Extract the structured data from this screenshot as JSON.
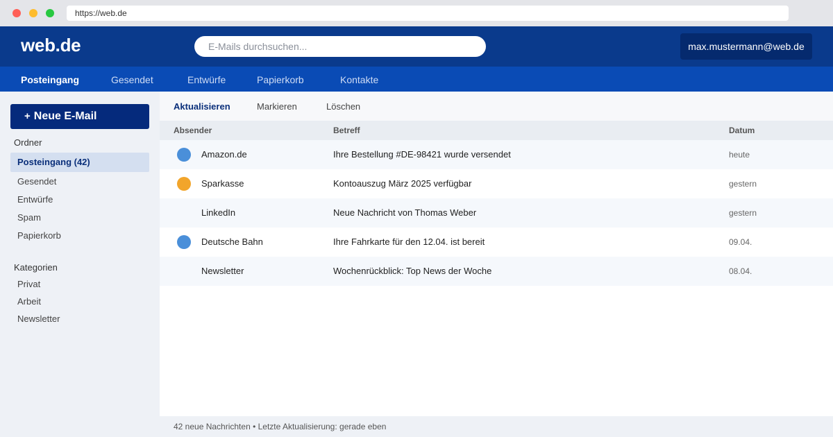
{
  "browser": {
    "url": "https://web.de"
  },
  "header": {
    "logo": "web.de",
    "search_placeholder": "E-Mails durchsuchen...",
    "account": "max.mustermann@web.de"
  },
  "nav": {
    "items": [
      "Posteingang",
      "Gesendet",
      "Entwürfe",
      "Papierkorb",
      "Kontakte"
    ],
    "active": "Posteingang"
  },
  "sidebar": {
    "compose_plus": "+",
    "compose_label": "Neue E-Mail",
    "folders_heading": "Ordner",
    "folders": [
      "Posteingang (42)",
      "Gesendet",
      "Entwürfe",
      "Spam",
      "Papierkorb"
    ],
    "categories_heading": "Kategorien",
    "categories": [
      "Privat",
      "Arbeit",
      "Newsletter"
    ]
  },
  "toolbar": {
    "items": [
      "Aktualisieren",
      "Markieren",
      "Löschen"
    ]
  },
  "table": {
    "columns": [
      "Absender",
      "Betreff",
      "Datum"
    ],
    "rows": [
      {
        "sender": "Amazon.de",
        "subject": "Ihre Bestellung #DE-98421 wurde versendet",
        "date": "heute",
        "indicator": "#4a8fd9"
      },
      {
        "sender": "Sparkasse",
        "subject": "Kontoauszug März 2025 verfügbar",
        "date": "gestern",
        "indicator": "#f2a52b"
      },
      {
        "sender": "LinkedIn",
        "subject": "Neue Nachricht von Thomas Weber",
        "date": "gestern",
        "indicator": ""
      },
      {
        "sender": "Deutsche Bahn",
        "subject": "Ihre Fahrkarte für den 12.04. ist bereit",
        "date": "09.04.",
        "indicator": "#4a8fd9"
      },
      {
        "sender": "Newsletter",
        "subject": "Wochenrückblick: Top News der Woche",
        "date": "08.04.",
        "indicator": ""
      }
    ]
  },
  "footer": {
    "status": "42 neue Nachrichten • Letzte Aktualisierung: gerade eben"
  },
  "colors": {
    "header_bg": "#0a3a8c",
    "nav_bg": "#0a4bb5",
    "compose_bg": "#052a7c",
    "active_folder_bg": "#d4dff0"
  }
}
